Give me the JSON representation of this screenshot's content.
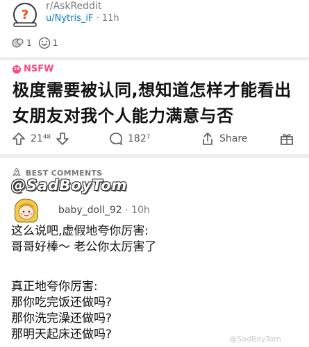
{
  "post": {
    "subreddit": "r/AskReddit",
    "author": "u/Nytris_iF",
    "separator": "·",
    "age": "11h",
    "awards": [
      {
        "icon": "hug-award-icon",
        "count": "1"
      },
      {
        "icon": "laugh-award-icon",
        "count": "1"
      }
    ],
    "nsfw_label": "NSFW",
    "title": "极度需要被认同,想知道怎样才能看出女朋友对我个人能力满意与否",
    "vote_count": "21⁴⁸",
    "comment_count": "182⁷",
    "share_label": "Share"
  },
  "comments": {
    "sort_label": "BEST COMMENTS",
    "banner_text": "@SadBoyTom",
    "top": {
      "author": "baby_doll_92",
      "separator": "·",
      "age": "10h",
      "lines": [
        "这么说吧,虚假地夸你厉害:",
        "哥哥好棒～ 老公你太厉害了",
        "真正地夸你厉害:",
        "那你吃完饭还做吗?",
        "那你洗完澡还做吗?",
        "那明天起床还做吗?"
      ]
    }
  },
  "watermark": "@SadBoyTom",
  "colors": {
    "link_blue": "#0079d3",
    "nsfw_pink": "#ff4a7d",
    "meta_gray": "#787c7e",
    "divider": "#ededed"
  }
}
